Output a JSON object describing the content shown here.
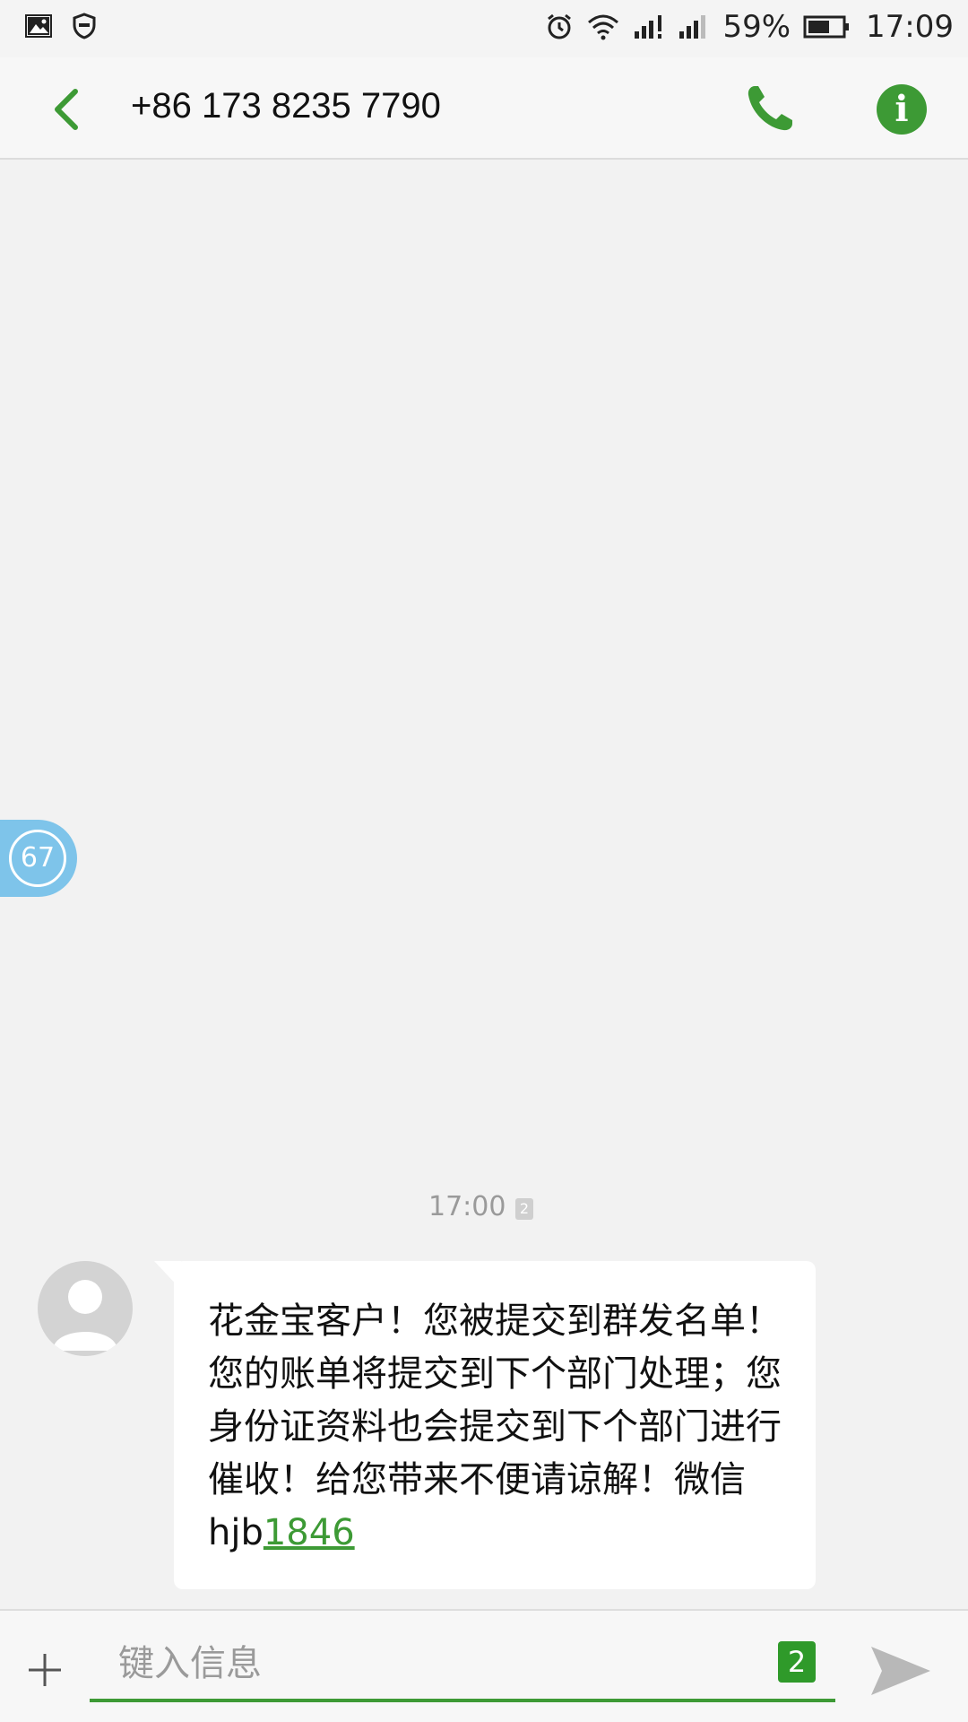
{
  "status_bar": {
    "battery_percent": "59%",
    "time": "17:09",
    "icons": [
      "gallery-icon",
      "vpn-shield-icon",
      "alarm-icon",
      "wifi-icon",
      "signal-icon",
      "signal-icon",
      "battery-icon"
    ]
  },
  "header": {
    "contact_number": "+86 173 8235 7790",
    "info_label": "i"
  },
  "floating_counter": {
    "count": "67"
  },
  "conversation": {
    "messages": [
      {
        "time": "17:00",
        "sim_slot": "2",
        "text_main": "花金宝客户！您被提交到群发名单！您的账单将提交到下个部门处理；您身份证资料也会提交到下个部门进行催收！给您带来不便请谅解！微信hjb",
        "text_link": "1846"
      }
    ]
  },
  "composer": {
    "placeholder": "键入信息",
    "sim_slot": "2"
  },
  "colors": {
    "accent": "#3d9a35",
    "background": "#f2f2f2",
    "bubble": "#ffffff"
  }
}
